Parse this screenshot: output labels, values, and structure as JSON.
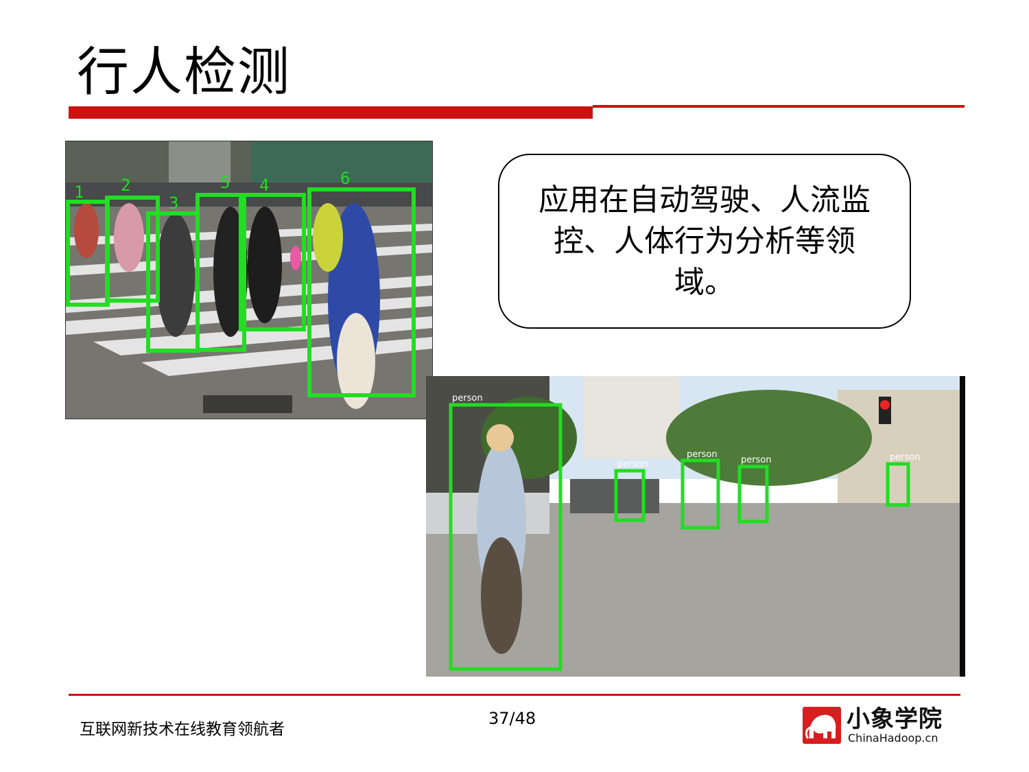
{
  "slide": {
    "title": "行人检测",
    "callout": "应用在自动驾驶、人流监控、人体行为分析等领域。",
    "footer_text": "互联网新技术在线教育领航者",
    "page_number": "37/48"
  },
  "photo1": {
    "box_labels": [
      "1",
      "2",
      "3",
      "5",
      "4",
      "6"
    ]
  },
  "photo2": {
    "box_label": "person"
  },
  "logo": {
    "name_cn": "小象学院",
    "name_en": "ChinaHadoop.cn"
  },
  "colors": {
    "accent": "#cc1111",
    "detection_box": "#22dd22"
  }
}
